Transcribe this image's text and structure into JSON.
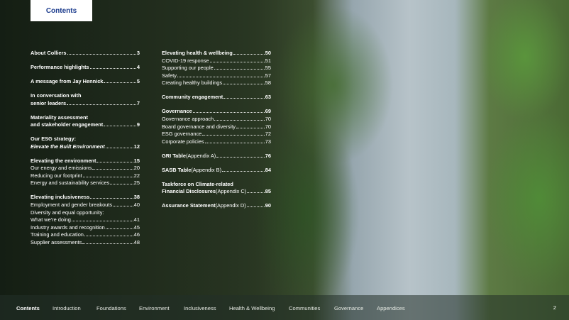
{
  "tab_label": "Contents",
  "col1": [
    {
      "type": "single",
      "title": "About Colliers",
      "page": "3"
    },
    {
      "type": "single",
      "title": "Performance highlights",
      "page": "4"
    },
    {
      "type": "single",
      "title": "A message from Jay Hennick",
      "page": "5"
    },
    {
      "type": "double",
      "line1": "In conversation with",
      "title": "senior leaders",
      "page": "7"
    },
    {
      "type": "double",
      "line1": "Materiality assessment",
      "title": "and stakeholder engagement",
      "page": "9"
    },
    {
      "type": "double_it",
      "line1": "Our ESG strategy:",
      "title": "Elevate the Built Environment",
      "page": "12"
    },
    {
      "type": "group",
      "title": "Elevating the environment",
      "page": "15",
      "subs": [
        {
          "t": "Our energy and emissions",
          "p": "20"
        },
        {
          "t": "Reducing our footprint",
          "p": "22"
        },
        {
          "t": "Energy and sustainability services",
          "p": "25"
        }
      ]
    },
    {
      "type": "group",
      "title": "Elevating inclusiveness",
      "page": "38",
      "subs": [
        {
          "t": "Employment and gender breakouts",
          "p": "40"
        },
        {
          "t": "Diversity and equal opportunity:",
          "p": ""
        },
        {
          "t": "What we're doing",
          "p": "41"
        },
        {
          "t": "Industry awards and recognition",
          "p": "45"
        },
        {
          "t": "Training and education",
          "p": "46"
        },
        {
          "t": "Supplier assessments",
          "p": "48"
        }
      ]
    }
  ],
  "col2": [
    {
      "type": "group",
      "title": "Elevating health & wellbeing",
      "page": "50",
      "subs": [
        {
          "t": "COVID-19 response",
          "p": "51"
        },
        {
          "t": "Supporting our people",
          "p": "55"
        },
        {
          "t": "Safety",
          "p": "57"
        },
        {
          "t": "Creating healthy buildings",
          "p": "58"
        }
      ]
    },
    {
      "type": "single",
      "title": "Community engagement",
      "page": "63"
    },
    {
      "type": "group",
      "title": "Governance",
      "page": "69",
      "subs": [
        {
          "t": "Governance approach",
          "p": "70"
        },
        {
          "t": "Board governance and diversity",
          "p": "70"
        },
        {
          "t": "ESG governance",
          "p": "72"
        },
        {
          "t": "Corporate policies",
          "p": "73"
        }
      ]
    },
    {
      "type": "mixed",
      "title": "GRI Table",
      "rest": " (Appendix A)",
      "page": "76"
    },
    {
      "type": "mixed",
      "title": "SASB Table",
      "rest": " (Appendix B)",
      "page": "84"
    },
    {
      "type": "mixed2",
      "line1": "Taskforce on Climate-related",
      "title": "Financial Disclosures",
      "rest": " (Appendix C)",
      "page": "85"
    },
    {
      "type": "mixed",
      "title": "Assurance Statement",
      "rest": " (Appendix D)",
      "page": "90"
    }
  ],
  "nav": [
    "Contents",
    "Introduction",
    "Foundations",
    "Environment",
    "Inclusiveness",
    "Health & Wellbeing",
    "Communities",
    "Governance",
    "Appendices"
  ],
  "nav_active": "Contents",
  "page_number": "2"
}
